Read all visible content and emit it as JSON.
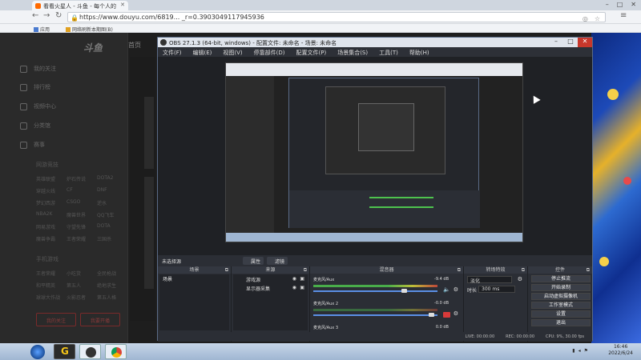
{
  "browser": {
    "tab_title": "看看火星人 - 斗鱼 - 每个人的",
    "url": "https://www.douyu.com/6819... _r=0.3903049117945936",
    "bookmarks": [
      "应用",
      "网络刷新本期图(B)"
    ]
  },
  "site": {
    "logo": "斗鱼",
    "home": "首页",
    "side_items": [
      "我的关注",
      "排行榜",
      "视频中心",
      "分类馆",
      "赛事"
    ],
    "sec_game": "网游竞技",
    "game_grid": [
      [
        "英雄联盟",
        "炉石传说",
        "DOTA2"
      ],
      [
        "穿越火线",
        "CF",
        "DNF"
      ],
      [
        "梦幻西游",
        "CSGO",
        "逆水"
      ],
      [
        "NBA2K",
        "魔兽世界",
        "QQ飞车"
      ],
      [
        "网易游戏",
        "守望先锋",
        "DOTA"
      ],
      [
        "魔兽争霸",
        "王者荣耀",
        "三国杀"
      ]
    ],
    "sec_mobile": "手机游戏",
    "mobile_grid": [
      [
        "王者荣耀",
        "小吃货",
        "全民枪战"
      ],
      [
        "和平精英",
        "第五人",
        "绝地求生"
      ],
      [
        "球球大作战",
        "火影忍者",
        "第五人格"
      ]
    ],
    "btn_left": "我的关注",
    "btn_right": "我要开播"
  },
  "obs": {
    "title": "OBS 27.1.3 (64-bit, windows) - 配置文件: 未命名 - 场景: 未命名",
    "menu": [
      "文件(F)",
      "编辑(E)",
      "视图(V)",
      "停靠部件(D)",
      "配置文件(P)",
      "场景集合(S)",
      "工具(T)",
      "帮助(H)"
    ],
    "scene_label": "未选择源",
    "chip_props": "属性",
    "chip_filters": "滤镜",
    "docks": {
      "scenes": "场景",
      "sources": "来源",
      "mixer": "混音器",
      "transitions": "转场特效",
      "controls": "控件"
    },
    "scene_item": "场景",
    "sources": [
      "游戏源",
      "显示器采集"
    ],
    "mixer": [
      {
        "name": "麦克风/Aux",
        "db": "-9.4 dB"
      },
      {
        "name": "麦克风/Aux 2",
        "db": "-0.0 dB"
      },
      {
        "name": "麦克风/Aux 3",
        "db": "0.0 dB"
      }
    ],
    "transition": {
      "type": "淡化",
      "duration_label": "时长",
      "duration": "300 ms"
    },
    "controls": [
      "停止推流",
      "开始录制",
      "启动虚拟摄像机",
      "工作室模式",
      "设置",
      "退出"
    ],
    "status": {
      "live": "LIVE: 00:00:00",
      "rec": "REC: 00:00:00",
      "cpu": "CPU: 9%, 30.00 fps"
    }
  },
  "taskbar": {
    "time": "16:46",
    "date": "2022/6/24"
  }
}
